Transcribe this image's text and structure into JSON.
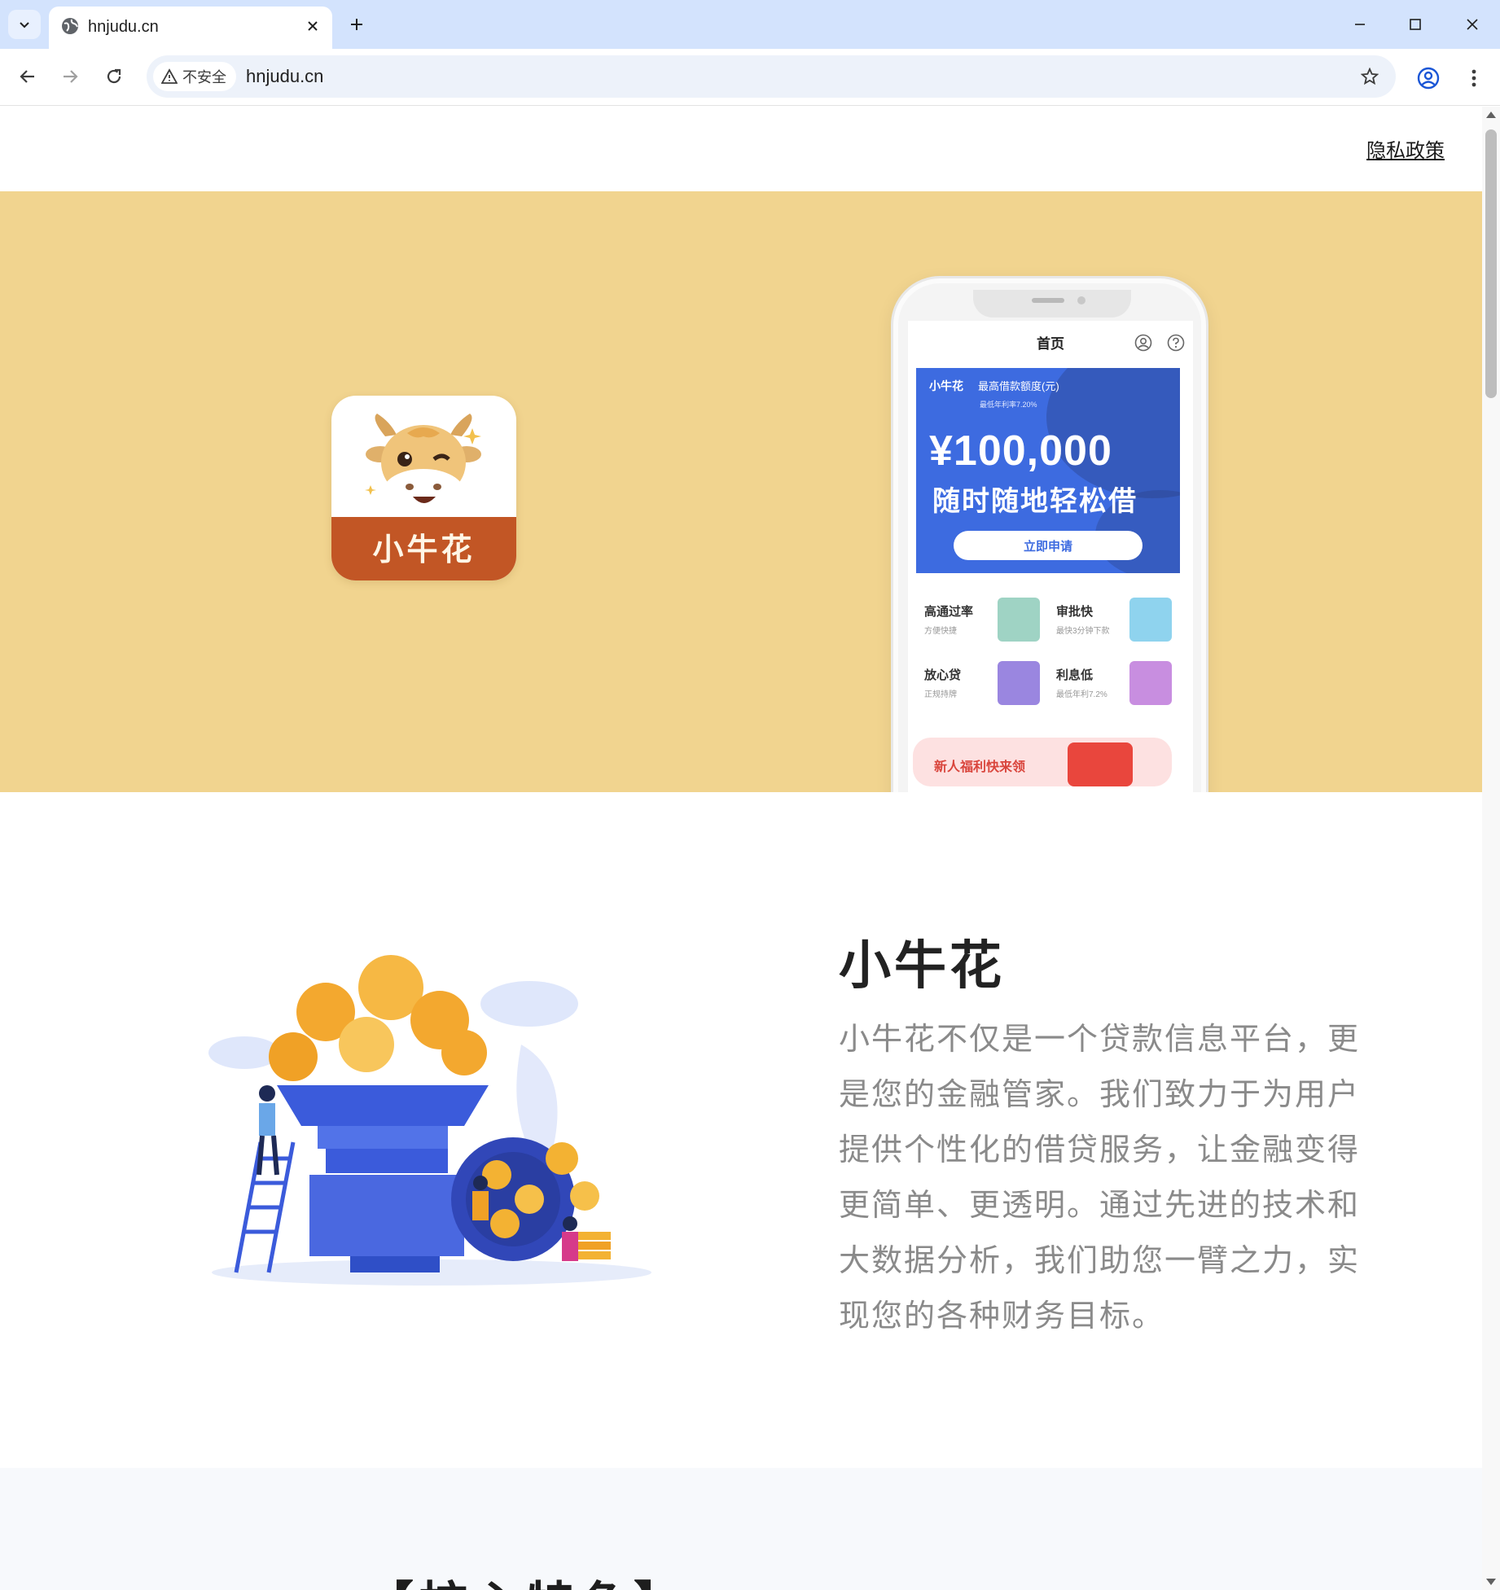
{
  "browser": {
    "tab_title": "hnjudu.cn",
    "security_label": "不安全",
    "url": "hnjudu.cn"
  },
  "page": {
    "privacy_link": "隐私政策",
    "hero": {
      "app_icon_name": "小牛花",
      "phone": {
        "screen_title": "首页",
        "banner_brand": "小牛花",
        "banner_limit_label": "最高借款额度(元)",
        "banner_rate": "最低年利率7.20%",
        "banner_amount": "¥100,000",
        "banner_slogan": "随时随地轻松借",
        "apply_button": "立即申请",
        "features": [
          {
            "title": "高通过率",
            "sub": "方便快捷"
          },
          {
            "title": "审批快",
            "sub": "最快3分钟下款"
          },
          {
            "title": "放心贷",
            "sub": "正规持牌"
          },
          {
            "title": "利息低",
            "sub": "最低年利7.2%"
          }
        ],
        "promo_text": "新人福利快来领"
      }
    },
    "about": {
      "title": "小牛花",
      "description": "小牛花不仅是一个贷款信息平台，更是您的金融管家。我们致力于为用户提供个性化的借贷服务，让金融变得更简单、更透明。通过先进的技术和大数据分析，我们助您一臂之力，实现您的各种财务目标。"
    },
    "core_title": "【核心特色】"
  },
  "colors": {
    "hero_bg": "#f1d48f",
    "banner_blue": "#3d6be0",
    "icon_orange": "#c25625",
    "chrome_tabbar": "#d3e3fd"
  }
}
